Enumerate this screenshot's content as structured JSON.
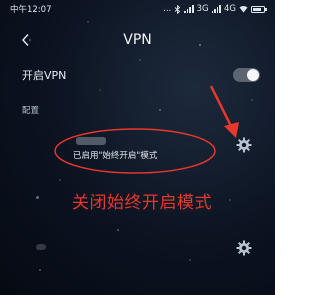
{
  "status_bar": {
    "time": "中午12:07",
    "network": "3G",
    "network2": "4G",
    "dots": "...",
    "bluetooth_icon": "bluetooth-icon",
    "battery_icon": "battery-icon"
  },
  "header": {
    "title": "VPN",
    "back_icon": "chevron-left-icon"
  },
  "vpn_toggle": {
    "label": "开启VPN",
    "enabled": true
  },
  "section": {
    "label": "配置"
  },
  "vpn_list": [
    {
      "status": "已启用\"始终开启\"模式",
      "settings_icon": "gear-icon"
    },
    {
      "status": "",
      "settings_icon": "gear-icon"
    }
  ],
  "annotation": {
    "text": "关闭始终开启模式",
    "color": "#e8372c"
  },
  "colors": {
    "background": "#0b1220",
    "accent_red": "#e8372c",
    "text": "#e8ecf2"
  }
}
